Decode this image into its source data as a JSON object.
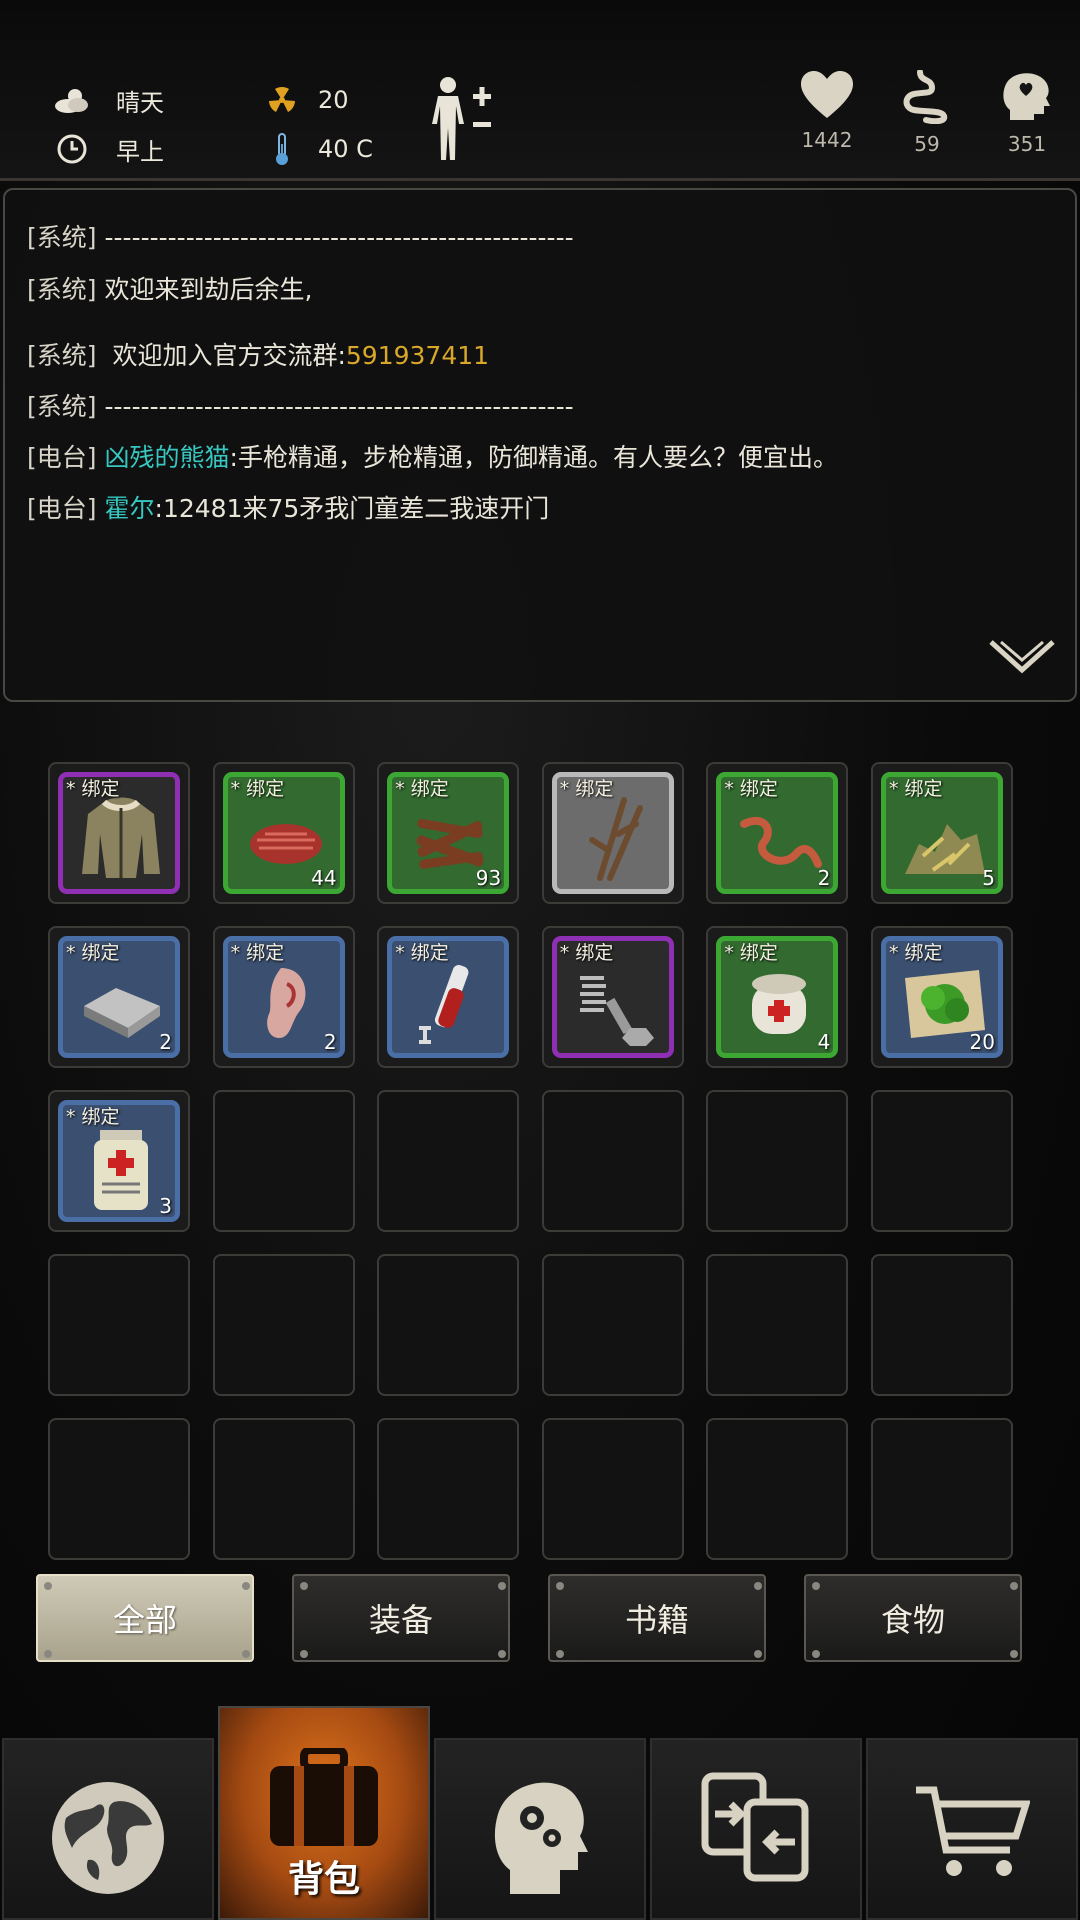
{
  "status": {
    "weather": "晴天",
    "time_of_day": "早上",
    "radiation": "20",
    "temperature": "40 C",
    "vitals": [
      {
        "name": "health",
        "value": "1442"
      },
      {
        "name": "hunger",
        "value": "59"
      },
      {
        "name": "sanity",
        "value": "351"
      }
    ]
  },
  "chat": {
    "lines": [
      {
        "tag": "[系统]",
        "name": "",
        "text": "----------------------------------------------------",
        "highlight": ""
      },
      {
        "tag": "[系统]",
        "name": "",
        "text": "欢迎来到劫后余生,",
        "highlight": ""
      },
      {
        "tag": "[系统]",
        "name": "",
        "text": " 欢迎加入官方交流群:",
        "highlight": "591937411"
      },
      {
        "tag": "[系统]",
        "name": "",
        "text": "----------------------------------------------------",
        "highlight": ""
      },
      {
        "tag": "[电台]",
        "name": "凶残的熊猫",
        "text": ":手枪精通，步枪精通，防御精通。有人要么？便宜出。",
        "highlight": ""
      },
      {
        "tag": "[电台]",
        "name": "霍尔",
        "text": ":12481来75矛我门童差二我速开门",
        "highlight": ""
      }
    ]
  },
  "inventory": {
    "bind_label": "* 绑定",
    "items": [
      {
        "icon": "jacket-icon",
        "rarity": "purple",
        "qty": ""
      },
      {
        "icon": "raw-meat-icon",
        "rarity": "green",
        "qty": "44"
      },
      {
        "icon": "firewood-icon",
        "rarity": "green",
        "qty": "93"
      },
      {
        "icon": "branches-icon",
        "rarity": "white",
        "qty": ""
      },
      {
        "icon": "worm-icon",
        "rarity": "green",
        "qty": "2"
      },
      {
        "icon": "scrap-pile-icon",
        "rarity": "green",
        "qty": "5"
      },
      {
        "icon": "metal-ingot-icon",
        "rarity": "blue",
        "qty": "2"
      },
      {
        "icon": "ear-icon",
        "rarity": "blue",
        "qty": "2"
      },
      {
        "icon": "blood-vial-icon",
        "rarity": "blue",
        "qty": ""
      },
      {
        "icon": "bolts-springs-icon",
        "rarity": "purple",
        "qty": ""
      },
      {
        "icon": "bandage-icon",
        "rarity": "green",
        "qty": "4"
      },
      {
        "icon": "herb-map-icon",
        "rarity": "blue",
        "qty": "20"
      },
      {
        "icon": "medicine-bottle-icon",
        "rarity": "blue",
        "qty": "3"
      }
    ],
    "total_slots": 30
  },
  "filters": [
    {
      "label": "全部",
      "active": true
    },
    {
      "label": "装备",
      "active": false
    },
    {
      "label": "书籍",
      "active": false
    },
    {
      "label": "食物",
      "active": false
    }
  ],
  "nav": {
    "tabs": [
      {
        "icon": "globe-icon",
        "label": ""
      },
      {
        "icon": "backpack-icon",
        "label": "背包"
      },
      {
        "icon": "skills-head-icon",
        "label": ""
      },
      {
        "icon": "trade-icon",
        "label": ""
      },
      {
        "icon": "shop-cart-icon",
        "label": ""
      }
    ]
  },
  "colors": {
    "rarity_purple": "#8f2fb3",
    "rarity_green": "#3ca833",
    "rarity_blue": "#4a6ea6",
    "rarity_white": "#b9b9b9",
    "player_name": "#36c7c0",
    "highlight": "#d9a82a",
    "active_tab": "#e0741c"
  }
}
